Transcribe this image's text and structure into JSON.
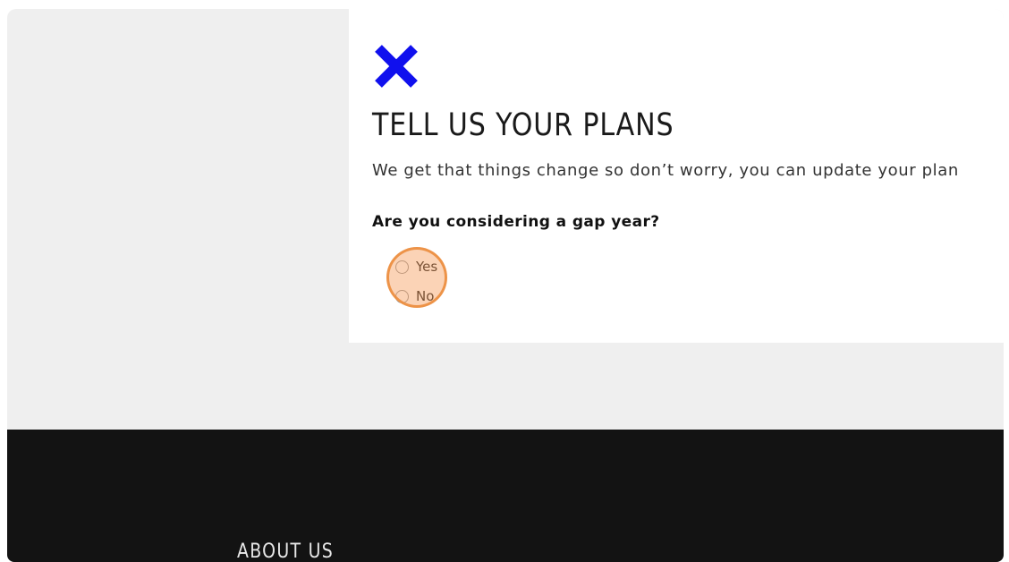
{
  "modal": {
    "close_icon": "close-icon",
    "accent_color": "#1010ee",
    "title": "TELL US YOUR PLANS",
    "subtitle": "We get that things change so don’t worry, you can update your plan",
    "question": "Are you considering a gap year?",
    "options": [
      {
        "label": "Yes",
        "selected": false
      },
      {
        "label": "No",
        "selected": false
      }
    ]
  },
  "footer": {
    "heading": "ABOUT US",
    "background": "#131313"
  }
}
